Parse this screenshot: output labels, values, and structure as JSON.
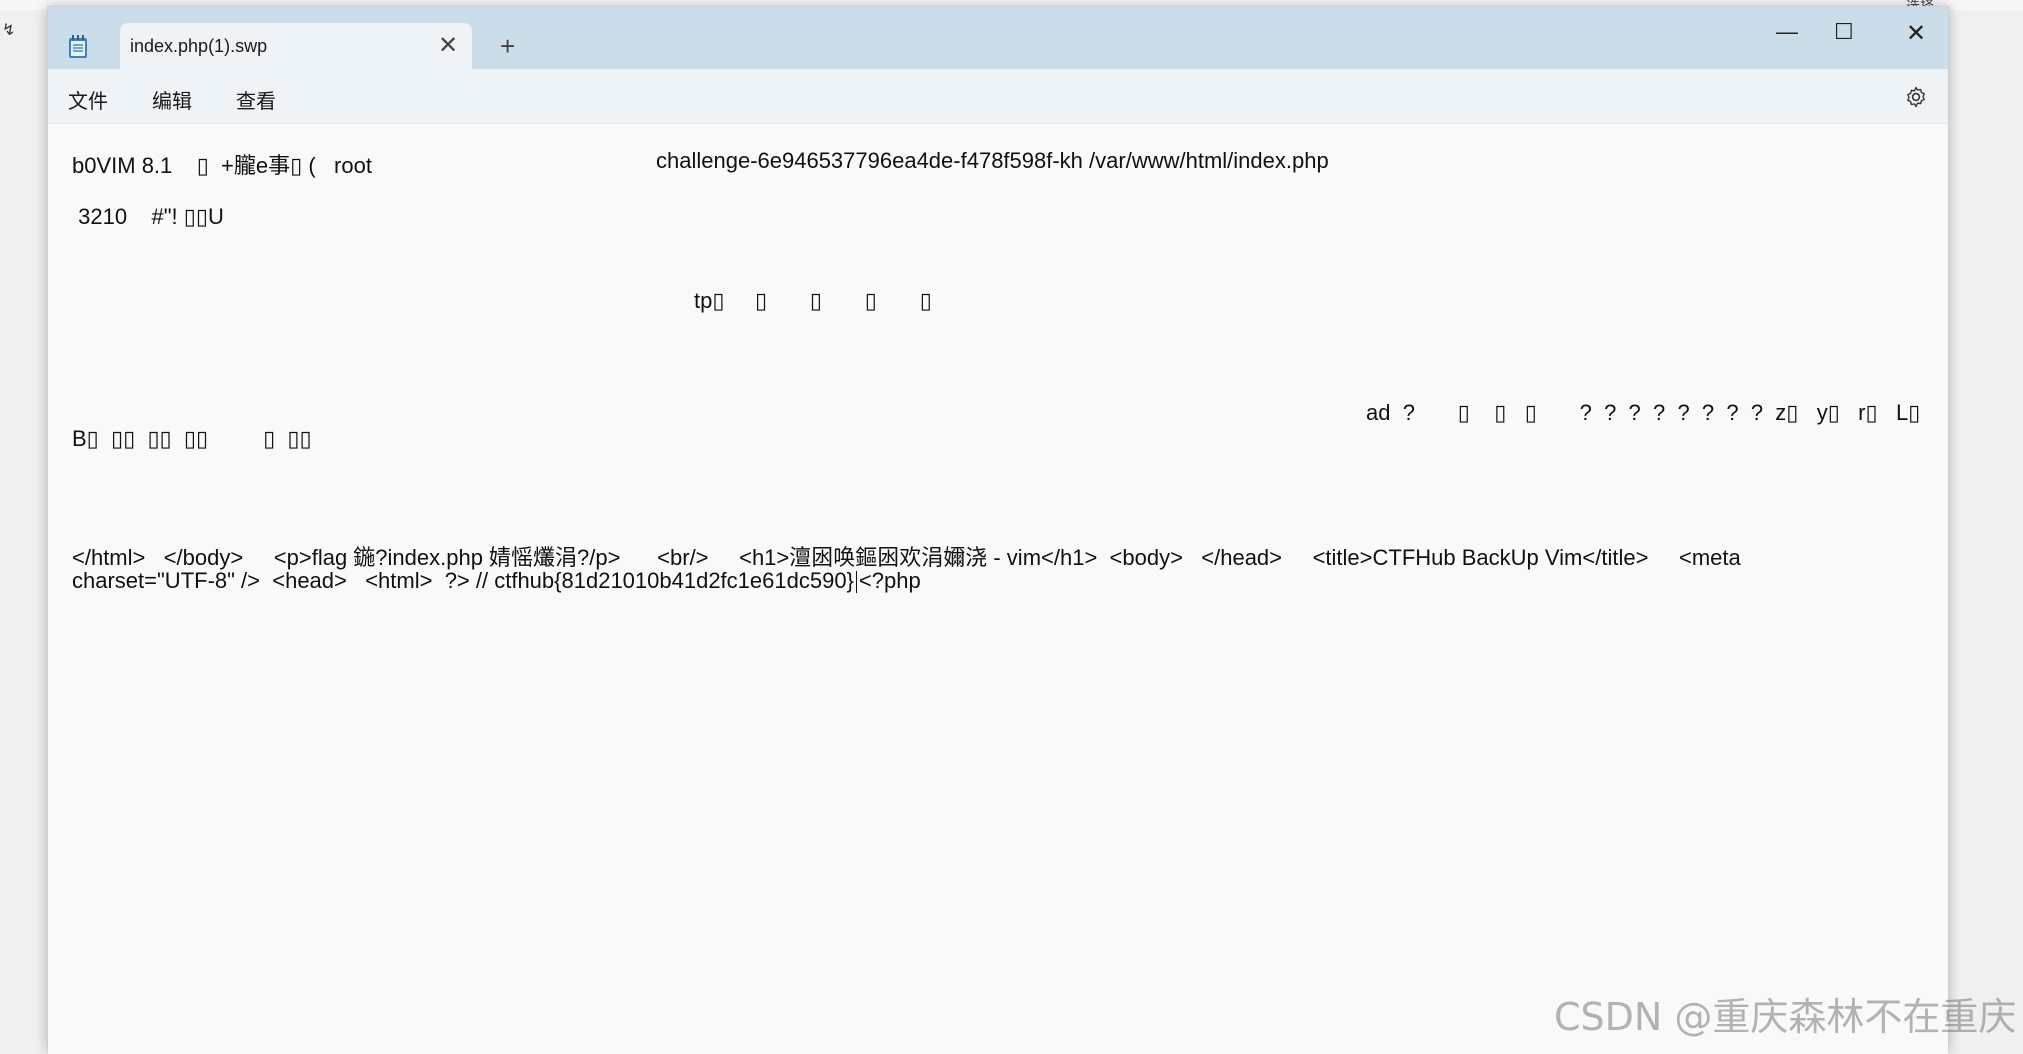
{
  "background": {
    "corner_glyph": "↯",
    "right_text": "选择"
  },
  "tab": {
    "title": "index.php(1).swp",
    "close": "✕",
    "new_tab": "+"
  },
  "window_controls": {
    "minimize": "—",
    "maximize": "☐",
    "close": "✕"
  },
  "menu": {
    "file": "文件",
    "edit": "编辑",
    "view": "查看"
  },
  "editor": {
    "line1_a": "b0VIM 8.1    ▯  +朧e事▯ (   root",
    "line1_b": "challenge-6e946537796ea4de-f478f598f-kh /var/www/html/index.php",
    "line2": " 3210    #\"! ▯▯U",
    "line3": "tp▯     ▯       ▯       ▯       ▯",
    "line4": "ad  ?       ▯    ▯   ▯       ?  ?  ?  ?  ?  ?  ?  ?  z▯   y▯   r▯   L▯",
    "line5": "B▯  ▯▯  ▯▯  ▯▯         ▯  ▯▯",
    "line6": "</html>   </body>     <p>flag 鍦?index.php 婧愮爜涓?/p>      <br/>     <h1>澶囦唤鏂囦欢涓嬭浇 - vim</h1>  <body>   </head>     <title>CTFHub BackUp Vim</title>     <meta",
    "line7_a": "charset=\"UTF-8\" />  <head>   <html>  ?> // ctfhub{81d21010b41d2fc1e61dc590}",
    "line7_b": "<?php"
  },
  "watermark": "CSDN @重庆森林不在重庆",
  "colors": {
    "titlebar": "#cadde9",
    "menubar": "#eef3f7",
    "editor_bg": "#f9f9f9",
    "tab_bg": "#eef3f7"
  }
}
